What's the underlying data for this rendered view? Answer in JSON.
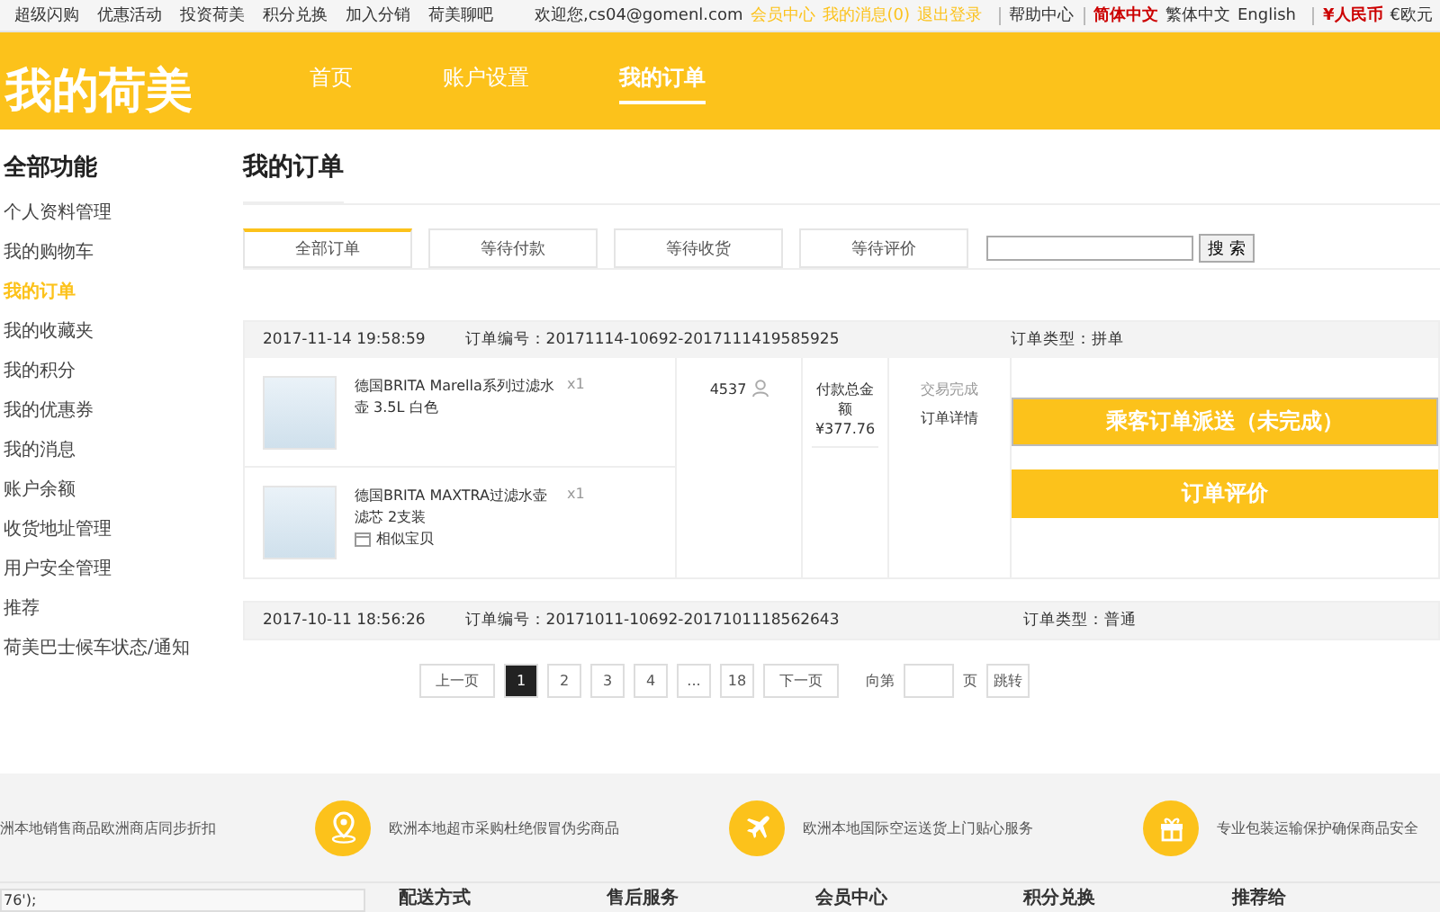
{
  "top_bar": {
    "left_links": [
      "超级闪购",
      "优惠活动",
      "投资荷美",
      "积分兑换",
      "加入分销",
      "荷美聊吧"
    ],
    "welcome": "欢迎您,cs04@gomenl.com",
    "user_links": [
      "会员中心",
      "我的消息(0)",
      "退出登录"
    ],
    "help": "帮助中心",
    "languages": [
      {
        "label": "简体中文",
        "selected": true
      },
      {
        "label": "繁体中文",
        "selected": false
      },
      {
        "label": "English",
        "selected": false
      }
    ],
    "currencies": [
      {
        "label": "¥人民币",
        "selected": true
      },
      {
        "label": "€欧元",
        "selected": false
      }
    ]
  },
  "header": {
    "logo": "我的荷美",
    "nav": [
      {
        "label": "首页",
        "selected": false
      },
      {
        "label": "账户设置",
        "selected": false
      },
      {
        "label": "我的订单",
        "selected": true
      }
    ]
  },
  "sidebar": {
    "title": "全部功能",
    "items": [
      {
        "label": "个人资料管理",
        "selected": false
      },
      {
        "label": "我的购物车",
        "selected": false
      },
      {
        "label": "我的订单",
        "selected": true
      },
      {
        "label": "我的收藏夹",
        "selected": false
      },
      {
        "label": "我的积分",
        "selected": false
      },
      {
        "label": "我的优惠券",
        "selected": false
      },
      {
        "label": "我的消息",
        "selected": false
      },
      {
        "label": "账户余额",
        "selected": false
      },
      {
        "label": "收货地址管理",
        "selected": false
      },
      {
        "label": "用户安全管理",
        "selected": false
      },
      {
        "label": "推荐",
        "selected": false
      },
      {
        "label": "荷美巴士候车状态/通知",
        "selected": false
      }
    ]
  },
  "page_title": "我的订单",
  "tabs": [
    {
      "label": "全部订单",
      "selected": true
    },
    {
      "label": "等待付款",
      "selected": false
    },
    {
      "label": "等待收货",
      "selected": false
    },
    {
      "label": "等待评价",
      "selected": false
    }
  ],
  "search": {
    "button": "搜 索"
  },
  "orders": [
    {
      "date": "2017-11-14 19:58:59",
      "number": "订单编号：20171114-10692-2017111419585925",
      "type": "订单类型：拼单",
      "items": [
        {
          "name": "德国BRITA Marella系列过滤水壶 3.5L 白色",
          "qty": "x1"
        },
        {
          "name": "德国BRITA MAXTRA过滤水壶滤芯 2支装",
          "qty": "x1",
          "similar": "相似宝贝"
        }
      ],
      "user": "4537",
      "total_label": "付款总金额",
      "total": "¥377.76",
      "status": "交易完成",
      "detail": "订单详情",
      "actions": [
        "乘客订单派送（未完成）",
        "订单评价"
      ]
    },
    {
      "date": "2017-10-11 18:56:26",
      "number": "订单编号：20171011-10692-2017101118562643",
      "type": "订单类型：普通"
    }
  ],
  "pagination": {
    "prev": "上一页",
    "pages": [
      {
        "label": "1",
        "selected": true
      },
      {
        "label": "2",
        "selected": false
      },
      {
        "label": "3",
        "selected": false
      },
      {
        "label": "4",
        "selected": false
      },
      {
        "label": "...",
        "selected": false
      },
      {
        "label": "18",
        "selected": false
      }
    ],
    "next": "下一页",
    "goto_before": "向第",
    "goto_after": "页",
    "goto_button": "跳转"
  },
  "features": [
    "洲本地销售商品欧洲商店同步折扣",
    "欧洲本地超市采购杜绝假冒伪劣商品",
    "欧洲本地国际空运送货上门贴心服务",
    "专业包装运输保护确保商品安全"
  ],
  "footer": {
    "field_text": "76');",
    "headings": [
      "配送方式",
      "售后服务",
      "会员中心",
      "积分兑换",
      "推荐给"
    ]
  }
}
